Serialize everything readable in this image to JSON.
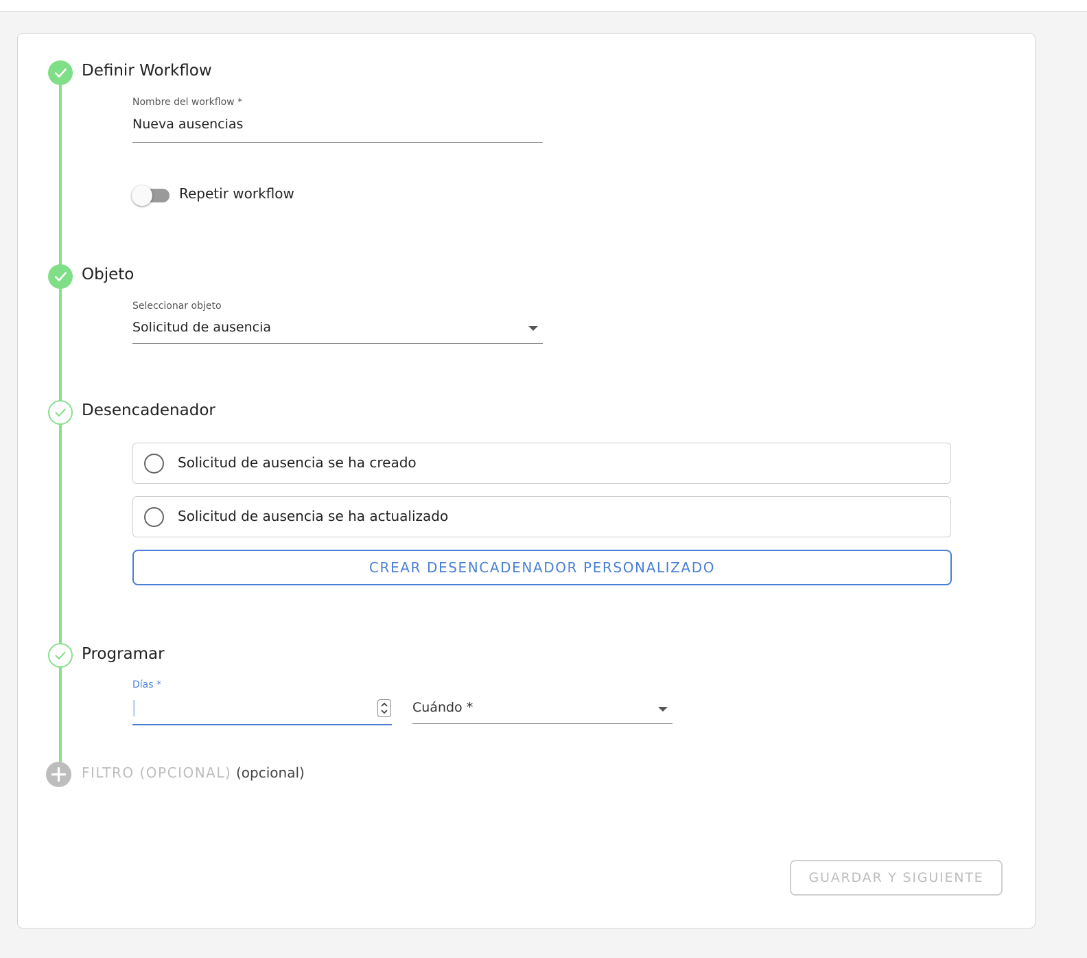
{
  "steps": {
    "define": {
      "title": "Definir Workflow",
      "status": "completed"
    },
    "object": {
      "title": "Objeto",
      "status": "completed"
    },
    "trigger": {
      "title": "Desencadenador",
      "status": "active"
    },
    "schedule": {
      "title": "Programar",
      "status": "active"
    },
    "filter": {
      "title": "FILTRO (OPCIONAL)",
      "suffix": "(opcional)",
      "status": "pending"
    }
  },
  "define": {
    "name_label": "Nombre del workflow *",
    "name_value": "Nueva ausencias",
    "repeat_label": "Repetir workflow",
    "repeat_on": false
  },
  "object": {
    "select_label": "Seleccionar objeto",
    "select_value": "Solicitud de ausencia"
  },
  "trigger": {
    "options": [
      {
        "label": "Solicitud de ausencia se ha creado",
        "selected": false
      },
      {
        "label": "Solicitud de ausencia se ha actualizado",
        "selected": false
      }
    ],
    "custom_button": "CREAR DESENCADENADOR PERSONALIZADO"
  },
  "schedule": {
    "days_label": "Días *",
    "days_value": "",
    "when_placeholder": "Cuándo *"
  },
  "footer": {
    "save_next": "GUARDAR Y SIGUIENTE"
  },
  "colors": {
    "step_green": "#7fdf86",
    "accent_blue": "#4a7fd4",
    "disabled_gray": "#bdbdbd"
  }
}
